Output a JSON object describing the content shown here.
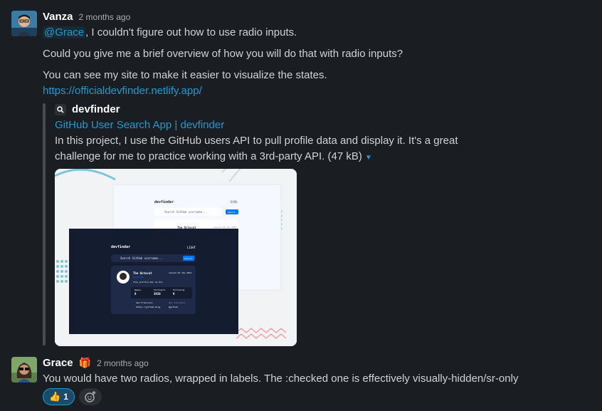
{
  "messages": [
    {
      "author": "Vanza",
      "time": "2 months ago",
      "mention": "@Grace",
      "line1_rest": ", I couldn't figure out how to use radio inputs.",
      "line2": "Could you give me a brief overview of how you will do that with radio inputs?",
      "line3": "You can see my site to make it easier to visualize the states.",
      "link": "https://officialdevfinder.netlify.app/",
      "attachment": {
        "site_name": "devfinder",
        "title": "GitHub User Search App | devfinder",
        "desc_line1": "In this project, I use the GitHub users API to pull profile data and display it. It's a great",
        "desc_line2": "challenge for me to practice working with a 3rd-party API. (47 kB)",
        "preview": {
          "logo": "devfinder",
          "search_placeholder": "Search GitHub username...",
          "search_button": "Search",
          "mode_dark": "LIGHT",
          "mode_light": "DARK",
          "profile_name": "The Octocat",
          "profile_joined": "Joined 25 Jan 2011",
          "profile_handle": "@octocat",
          "profile_bio": "This profile has no bio",
          "stat_repos_label": "Repos",
          "stat_repos": "8",
          "stat_followers_label": "Followers",
          "stat_followers": "3938",
          "stat_following_label": "Following",
          "stat_following": "9",
          "link_location": "San Francisco",
          "link_twitter": "Not Available",
          "link_blog": "https://github.blog",
          "link_company": "@github"
        }
      }
    },
    {
      "author": "Grace",
      "author_emoji": "🎁",
      "time": "2 months ago",
      "text": "You would have two radios, wrapped in labels. The :checked one is effectively visually-hidden/sr-only",
      "reactions": [
        {
          "emoji": "👍",
          "count": "1"
        }
      ],
      "add_reaction_icon": "add-reaction-icon"
    }
  ]
}
